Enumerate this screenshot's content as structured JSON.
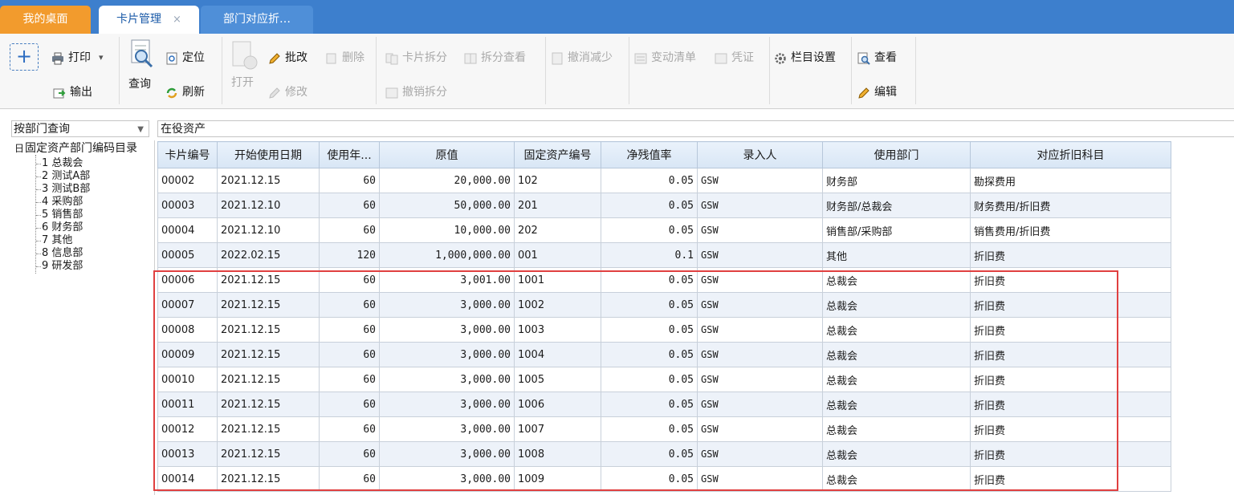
{
  "tabs": [
    {
      "label": "我的桌面"
    },
    {
      "label": "卡片管理",
      "close": "×"
    },
    {
      "label": "部门对应折…"
    }
  ],
  "toolbar": {
    "add": "+",
    "print": "打印",
    "print_arrow": "▾",
    "export": "输出",
    "query": "查询",
    "locate": "定位",
    "refresh": "刷新",
    "open": "打开",
    "batch_edit": "批改",
    "edit": "修改",
    "delete": "删除",
    "card_split": "卡片拆分",
    "split_view": "拆分查看",
    "cancel_split": "撤销拆分",
    "cancel_reduce": "撤消减少",
    "change_list": "变动清单",
    "voucher": "凭证",
    "column_settings": "栏目设置",
    "view": "查看",
    "editor": "编辑"
  },
  "filter": {
    "value": "按部门查询",
    "arrow": "▼"
  },
  "status": "在役资产",
  "tree": {
    "toggle": "日",
    "root": "固定资产部门编码目录",
    "items": [
      "1 总裁会",
      "2 测试A部",
      "3 测试B部",
      "4 采购部",
      "5 销售部",
      "6 财务部",
      "7 其他",
      "8 信息部",
      "9 研发部"
    ]
  },
  "grid": {
    "columns": [
      "卡片编号",
      "开始使用日期",
      "使用年...",
      "原值",
      "固定资产编号",
      "净残值率",
      "录入人",
      "使用部门",
      "对应折旧科目"
    ],
    "rows": [
      [
        "00002",
        "2021.12.15",
        "60",
        "20,000.00",
        "102",
        "0.05",
        "GSW",
        "财务部",
        "勘探费用"
      ],
      [
        "00003",
        "2021.12.10",
        "60",
        "50,000.00",
        "201",
        "0.05",
        "GSW",
        "财务部/总裁会",
        "财务费用/折旧费"
      ],
      [
        "00004",
        "2021.12.10",
        "60",
        "10,000.00",
        "202",
        "0.05",
        "GSW",
        "销售部/采购部",
        "销售费用/折旧费"
      ],
      [
        "00005",
        "2022.02.15",
        "120",
        "1,000,000.00",
        "001",
        "0.1",
        "GSW",
        "其他",
        "折旧费"
      ],
      [
        "00006",
        "2021.12.15",
        "60",
        "3,001.00",
        "1001",
        "0.05",
        "GSW",
        "总裁会",
        "折旧费"
      ],
      [
        "00007",
        "2021.12.15",
        "60",
        "3,000.00",
        "1002",
        "0.05",
        "GSW",
        "总裁会",
        "折旧费"
      ],
      [
        "00008",
        "2021.12.15",
        "60",
        "3,000.00",
        "1003",
        "0.05",
        "GSW",
        "总裁会",
        "折旧费"
      ],
      [
        "00009",
        "2021.12.15",
        "60",
        "3,000.00",
        "1004",
        "0.05",
        "GSW",
        "总裁会",
        "折旧费"
      ],
      [
        "00010",
        "2021.12.15",
        "60",
        "3,000.00",
        "1005",
        "0.05",
        "GSW",
        "总裁会",
        "折旧费"
      ],
      [
        "00011",
        "2021.12.15",
        "60",
        "3,000.00",
        "1006",
        "0.05",
        "GSW",
        "总裁会",
        "折旧费"
      ],
      [
        "00012",
        "2021.12.15",
        "60",
        "3,000.00",
        "1007",
        "0.05",
        "GSW",
        "总裁会",
        "折旧费"
      ],
      [
        "00013",
        "2021.12.15",
        "60",
        "3,000.00",
        "1008",
        "0.05",
        "GSW",
        "总裁会",
        "折旧费"
      ],
      [
        "00014",
        "2021.12.15",
        "60",
        "3,000.00",
        "1009",
        "0.05",
        "GSW",
        "总裁会",
        "折旧费"
      ]
    ]
  },
  "colors": {
    "tabbar": "#3d7fcd",
    "home_tab": "#f29b2d",
    "highlight": "#e04040"
  }
}
